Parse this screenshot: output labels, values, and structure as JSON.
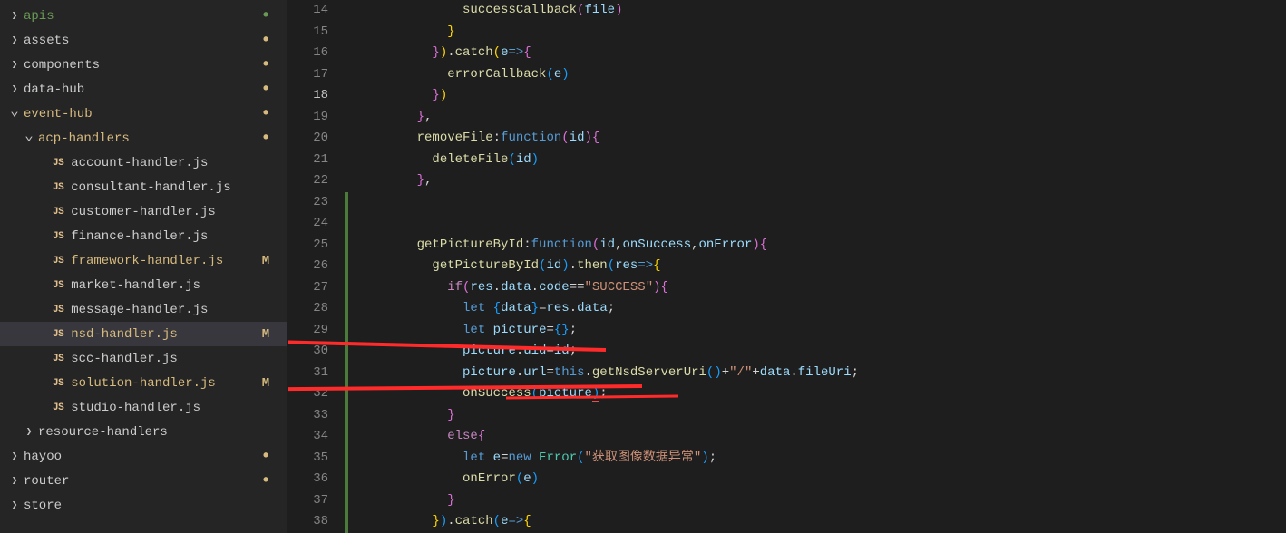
{
  "sidebar": {
    "items": [
      {
        "kind": "folder",
        "label": "apis",
        "depth": 0,
        "collapsed": true,
        "git": "green",
        "status": "dot-green"
      },
      {
        "kind": "folder",
        "label": "assets",
        "depth": 0,
        "collapsed": true,
        "git": "",
        "status": "dot"
      },
      {
        "kind": "folder",
        "label": "components",
        "depth": 0,
        "collapsed": true,
        "git": "",
        "status": "dot"
      },
      {
        "kind": "folder",
        "label": "data-hub",
        "depth": 0,
        "collapsed": true,
        "git": "",
        "status": "dot"
      },
      {
        "kind": "folder",
        "label": "event-hub",
        "depth": 0,
        "collapsed": false,
        "git": "yellow",
        "status": "dot"
      },
      {
        "kind": "folder",
        "label": "acp-handlers",
        "depth": 1,
        "collapsed": false,
        "git": "yellow",
        "status": "dot"
      },
      {
        "kind": "file",
        "label": "account-handler.js",
        "depth": 2,
        "git": "",
        "status": ""
      },
      {
        "kind": "file",
        "label": "consultant-handler.js",
        "depth": 2,
        "git": "",
        "status": ""
      },
      {
        "kind": "file",
        "label": "customer-handler.js",
        "depth": 2,
        "git": "",
        "status": ""
      },
      {
        "kind": "file",
        "label": "finance-handler.js",
        "depth": 2,
        "git": "",
        "status": ""
      },
      {
        "kind": "file",
        "label": "framework-handler.js",
        "depth": 2,
        "git": "yellow",
        "status": "M"
      },
      {
        "kind": "file",
        "label": "market-handler.js",
        "depth": 2,
        "git": "",
        "status": ""
      },
      {
        "kind": "file",
        "label": "message-handler.js",
        "depth": 2,
        "git": "",
        "status": ""
      },
      {
        "kind": "file",
        "label": "nsd-handler.js",
        "depth": 2,
        "git": "yellow",
        "status": "M",
        "selected": true
      },
      {
        "kind": "file",
        "label": "scc-handler.js",
        "depth": 2,
        "git": "",
        "status": ""
      },
      {
        "kind": "file",
        "label": "solution-handler.js",
        "depth": 2,
        "git": "yellow",
        "status": "M"
      },
      {
        "kind": "file",
        "label": "studio-handler.js",
        "depth": 2,
        "git": "",
        "status": ""
      },
      {
        "kind": "folder",
        "label": "resource-handlers",
        "depth": 1,
        "collapsed": true,
        "git": "",
        "status": ""
      },
      {
        "kind": "folder",
        "label": "hayoo",
        "depth": 0,
        "collapsed": true,
        "git": "",
        "status": "dot"
      },
      {
        "kind": "folder",
        "label": "router",
        "depth": 0,
        "collapsed": true,
        "git": "",
        "status": "dot"
      },
      {
        "kind": "folder",
        "label": "store",
        "depth": 0,
        "collapsed": true,
        "git": "",
        "status": ""
      }
    ]
  },
  "editor": {
    "first_line_no": 14,
    "current_line_index": 4,
    "modified_ranges": [
      [
        23,
        38
      ]
    ],
    "lines": [
      [
        [
          "fn",
          "successCallback"
        ],
        [
          "brace2",
          "("
        ],
        [
          "var",
          "file"
        ],
        [
          "brace2",
          ")"
        ]
      ],
      [
        [
          "brace1",
          "}"
        ]
      ],
      [
        [
          "brace2",
          "}"
        ],
        [
          "brace1",
          ")"
        ],
        [
          "pun",
          "."
        ],
        [
          "fn",
          "catch"
        ],
        [
          "brace1",
          "("
        ],
        [
          "var",
          "e"
        ],
        [
          "kw",
          "=>"
        ],
        [
          "brace2",
          "{"
        ]
      ],
      [
        [
          "fn",
          "errorCallback"
        ],
        [
          "brace3",
          "("
        ],
        [
          "var",
          "e"
        ],
        [
          "brace3",
          ")"
        ]
      ],
      [
        [
          "brace2",
          "}"
        ],
        [
          "brace1",
          ")"
        ]
      ],
      [
        [
          "brace2",
          "}"
        ],
        [
          "pun",
          ","
        ]
      ],
      [
        [
          "fn",
          "removeFile"
        ],
        [
          "pun",
          ":"
        ],
        [
          "kw",
          "function"
        ],
        [
          "brace2",
          "("
        ],
        [
          "var",
          "id"
        ],
        [
          "brace2",
          ")"
        ],
        [
          "brace2",
          "{"
        ]
      ],
      [
        [
          "fn",
          "deleteFile"
        ],
        [
          "brace3",
          "("
        ],
        [
          "var",
          "id"
        ],
        [
          "brace3",
          ")"
        ]
      ],
      [
        [
          "brace2",
          "}"
        ],
        [
          "pun",
          ","
        ]
      ],
      [],
      [],
      [
        [
          "fn",
          "getPictureById"
        ],
        [
          "pun",
          ":"
        ],
        [
          "kw",
          "function"
        ],
        [
          "brace2",
          "("
        ],
        [
          "var",
          "id"
        ],
        [
          "pun",
          ","
        ],
        [
          "var",
          "onSuccess"
        ],
        [
          "pun",
          ","
        ],
        [
          "var",
          "onError"
        ],
        [
          "brace2",
          ")"
        ],
        [
          "brace2",
          "{"
        ]
      ],
      [
        [
          "fn",
          "getPictureById"
        ],
        [
          "brace3",
          "("
        ],
        [
          "var",
          "id"
        ],
        [
          "brace3",
          ")"
        ],
        [
          "pun",
          "."
        ],
        [
          "fn",
          "then"
        ],
        [
          "brace3",
          "("
        ],
        [
          "var",
          "res"
        ],
        [
          "kw",
          "=>"
        ],
        [
          "brace1",
          "{"
        ]
      ],
      [
        [
          "kw2",
          "if"
        ],
        [
          "brace2",
          "("
        ],
        [
          "var",
          "res"
        ],
        [
          "pun",
          "."
        ],
        [
          "var",
          "data"
        ],
        [
          "pun",
          "."
        ],
        [
          "var",
          "code"
        ],
        [
          "pun",
          "=="
        ],
        [
          "str",
          "\"SUCCESS\""
        ],
        [
          "brace2",
          ")"
        ],
        [
          "brace2",
          "{"
        ]
      ],
      [
        [
          "kw",
          "let"
        ],
        [
          "pun",
          " "
        ],
        [
          "brace3",
          "{"
        ],
        [
          "var",
          "data"
        ],
        [
          "brace3",
          "}"
        ],
        [
          "pun",
          "="
        ],
        [
          "var",
          "res"
        ],
        [
          "pun",
          "."
        ],
        [
          "var",
          "data"
        ],
        [
          "pun",
          ";"
        ]
      ],
      [
        [
          "kw",
          "let"
        ],
        [
          "pun",
          " "
        ],
        [
          "var",
          "picture"
        ],
        [
          "pun",
          "="
        ],
        [
          "brace3",
          "{"
        ],
        [
          "brace3",
          "}"
        ],
        [
          "pun",
          ";"
        ]
      ],
      [
        [
          "var",
          "picture"
        ],
        [
          "pun",
          "."
        ],
        [
          "var",
          "uid"
        ],
        [
          "pun",
          "="
        ],
        [
          "var",
          "id"
        ],
        [
          "pun",
          ";"
        ]
      ],
      [
        [
          "var",
          "picture"
        ],
        [
          "pun",
          "."
        ],
        [
          "var",
          "url"
        ],
        [
          "pun",
          "="
        ],
        [
          "this",
          "this"
        ],
        [
          "pun",
          "."
        ],
        [
          "fn",
          "getNsdServerUri"
        ],
        [
          "brace3",
          "("
        ],
        [
          "brace3",
          ")"
        ],
        [
          "pun",
          "+"
        ],
        [
          "str",
          "\"/\""
        ],
        [
          "pun",
          "+"
        ],
        [
          "var",
          "data"
        ],
        [
          "pun",
          "."
        ],
        [
          "var",
          "fileUri"
        ],
        [
          "pun",
          ";"
        ]
      ],
      [
        [
          "fn",
          "onSuccess"
        ],
        [
          "brace3",
          "("
        ],
        [
          "var",
          "picture"
        ],
        [
          "brace3_err",
          ")"
        ],
        [
          "pun",
          ";"
        ]
      ],
      [
        [
          "brace2",
          "}"
        ]
      ],
      [
        [
          "kw2",
          "else"
        ],
        [
          "brace2",
          "{"
        ]
      ],
      [
        [
          "kw",
          "let"
        ],
        [
          "pun",
          " "
        ],
        [
          "var",
          "e"
        ],
        [
          "pun",
          "="
        ],
        [
          "kw",
          "new"
        ],
        [
          "pun",
          " "
        ],
        [
          "type",
          "Error"
        ],
        [
          "brace3",
          "("
        ],
        [
          "str",
          "\"获取图像数据异常\""
        ],
        [
          "brace3",
          ")"
        ],
        [
          "pun",
          ";"
        ]
      ],
      [
        [
          "fn",
          "onError"
        ],
        [
          "brace3",
          "("
        ],
        [
          "var",
          "e"
        ],
        [
          "brace3",
          ")"
        ]
      ],
      [
        [
          "brace2",
          "}"
        ]
      ],
      [
        [
          "brace1",
          "}"
        ],
        [
          "brace3",
          ")"
        ],
        [
          "pun",
          "."
        ],
        [
          "fn",
          "catch"
        ],
        [
          "brace3",
          "("
        ],
        [
          "var",
          "e"
        ],
        [
          "kw",
          "=>"
        ],
        [
          "brace1",
          "{"
        ]
      ]
    ],
    "indents": [
      15,
      13,
      11,
      13,
      11,
      9,
      9,
      11,
      9,
      0,
      0,
      9,
      11,
      13,
      15,
      15,
      15,
      15,
      15,
      13,
      13,
      15,
      15,
      13,
      11
    ]
  },
  "annotations": {
    "arrow1_target_file": "nsd-handler.js",
    "arrow2_target_file": "solution-handler.js"
  }
}
